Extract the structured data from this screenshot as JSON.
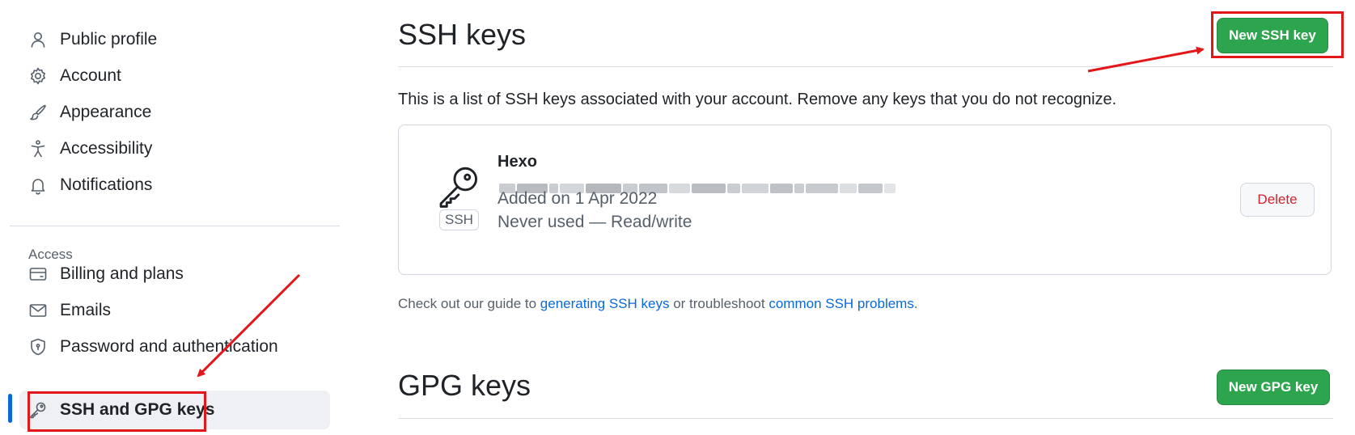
{
  "sidebar": {
    "items": [
      {
        "label": "Public profile",
        "icon": "person-icon"
      },
      {
        "label": "Account",
        "icon": "gear-icon"
      },
      {
        "label": "Appearance",
        "icon": "paintbrush-icon"
      },
      {
        "label": "Accessibility",
        "icon": "accessibility-icon"
      },
      {
        "label": "Notifications",
        "icon": "bell-icon"
      }
    ],
    "access_heading": "Access",
    "access_items": [
      {
        "label": "Billing and plans",
        "icon": "credit-card-icon"
      },
      {
        "label": "Emails",
        "icon": "mail-icon"
      },
      {
        "label": "Password and authentication",
        "icon": "shield-icon"
      },
      {
        "label": "SSH and GPG keys",
        "icon": "key-icon",
        "active": true
      }
    ]
  },
  "ssh": {
    "title": "SSH keys",
    "new_button": "New SSH key",
    "description": "This is a list of SSH keys associated with your account. Remove any keys that you do not recognize.",
    "key": {
      "title": "Hexo",
      "badge": "SSH",
      "added": "Added on 1 Apr 2022",
      "usage": "Never used — Read/write",
      "delete_button": "Delete"
    },
    "guide": {
      "prefix": "Check out our guide to ",
      "link1": "generating SSH keys",
      "middle": " or troubleshoot ",
      "link2": "common SSH problems",
      "suffix": "."
    }
  },
  "gpg": {
    "title": "GPG keys",
    "new_button": "New GPG key"
  },
  "colors": {
    "accent": "#0969da",
    "primary_button": "#2da44e",
    "danger": "#cf222e",
    "annotation": "#e3161a"
  }
}
